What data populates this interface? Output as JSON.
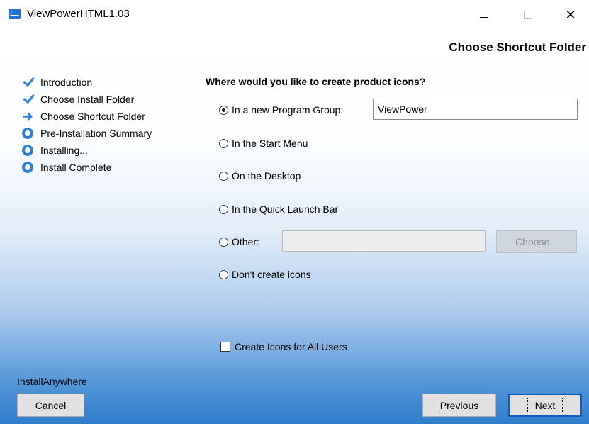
{
  "window": {
    "title": "ViewPowerHTML1.03"
  },
  "header": {
    "heading": "Choose Shortcut Folder"
  },
  "steps": [
    {
      "label": "Introduction",
      "icon": "check-icon"
    },
    {
      "label": "Choose Install Folder",
      "icon": "check-icon"
    },
    {
      "label": "Choose Shortcut Folder",
      "icon": "arrow-right-icon"
    },
    {
      "label": "Pre-Installation Summary",
      "icon": "circle-icon"
    },
    {
      "label": "Installing...",
      "icon": "circle-icon"
    },
    {
      "label": "Install Complete",
      "icon": "circle-icon"
    }
  ],
  "main": {
    "question": "Where would you like to create product icons?",
    "options": {
      "new_group": "In a new Program Group:",
      "start_menu": "In the Start Menu",
      "desktop": "On the Desktop",
      "quick_launch": "In the Quick Launch Bar",
      "other": "Other:",
      "no_icons": "Don't create icons"
    },
    "selected_option": "new_group",
    "program_group_value": "ViewPower",
    "other_value": "",
    "choose_button": "Choose...",
    "all_users_label": "Create Icons for All Users",
    "all_users_checked": false
  },
  "footer": {
    "brand": "InstallAnywhere",
    "cancel": "Cancel",
    "previous": "Previous",
    "next": "Next"
  },
  "colors": {
    "accent": "#2e7fd6",
    "gradient_bottom": "#2e7ccb"
  }
}
